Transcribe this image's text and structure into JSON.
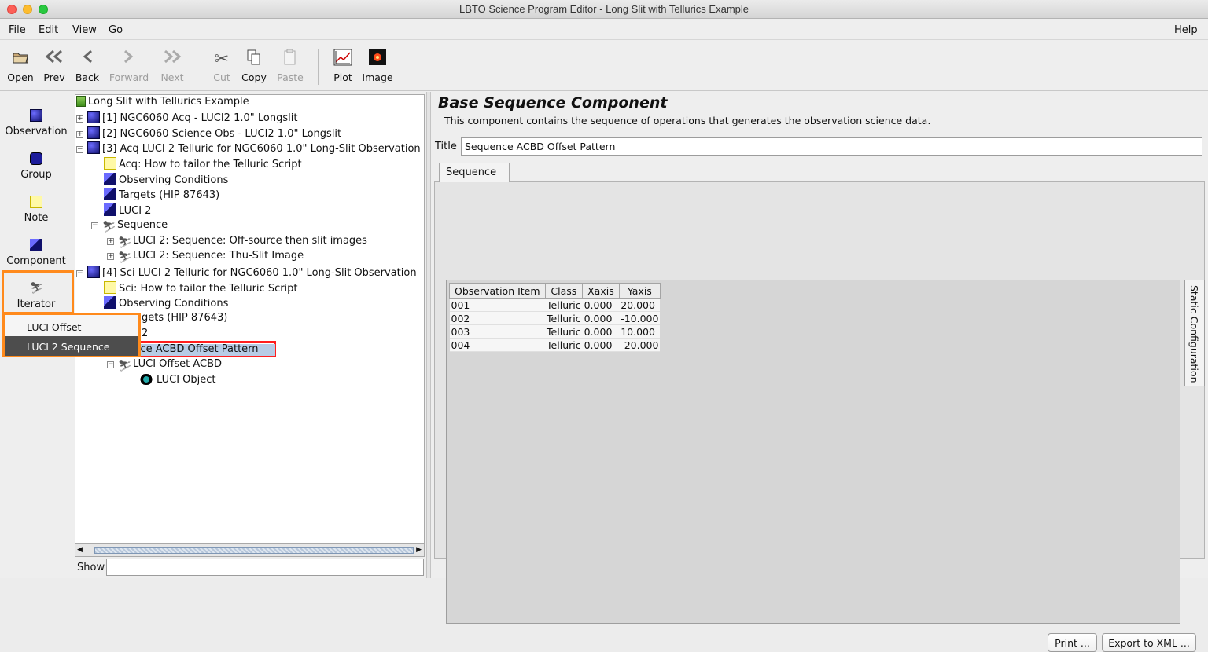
{
  "window": {
    "title": "LBTO Science Program Editor - Long Slit with Tellurics Example"
  },
  "menu": {
    "file": "File",
    "edit": "Edit",
    "view": "View",
    "go": "Go",
    "help": "Help"
  },
  "toolbar": {
    "open": "Open",
    "prev": "Prev",
    "back": "Back",
    "forward": "Forward",
    "next": "Next",
    "cut": "Cut",
    "copy": "Copy",
    "paste": "Paste",
    "plot": "Plot",
    "image": "Image"
  },
  "palette": {
    "observation": "Observation",
    "group": "Group",
    "note": "Note",
    "component": "Component",
    "iterator": "Iterator"
  },
  "iterator_popup": {
    "items": [
      "LUCI Offset",
      "LUCI 2 Sequence"
    ],
    "selected": "LUCI 2 Sequence"
  },
  "tree": {
    "root": "Long Slit with Tellurics Example",
    "n1": "[1] NGC6060 Acq - LUCI2 1.0\" Longslit",
    "n2": "[2] NGC6060 Science Obs - LUCI2 1.0\" Longslit",
    "n3": "[3] Acq LUCI 2 Telluric for NGC6060 1.0\" Long-Slit Observation",
    "n3_note": "Acq: How to tailor the Telluric Script",
    "n3_cond": "Observing Conditions",
    "n3_targets": "Targets (HIP 87643)",
    "n3_inst": "LUCI 2",
    "n3_seq": "Sequence",
    "n3_seq_a": "LUCI 2: Sequence: Off-source then slit images",
    "n3_seq_b": "LUCI 2: Sequence: Thu-Slit Image",
    "n4": "[4] Sci LUCI 2 Telluric for NGC6060 1.0\" Long-Slit Observation",
    "n4_note": "Sci: How to tailor the Telluric Script",
    "n4_cond": "Observing Conditions",
    "n4_targets_visible": "gets (HIP 87643)",
    "n4_inst_visible": "2",
    "n4_seq_visible": "uence ACBD Offset Pattern",
    "n4_offset": "LUCI Offset ACBD",
    "n4_object": "LUCI Object"
  },
  "show": {
    "label": "Show",
    "value": ""
  },
  "component": {
    "heading": "Base Sequence Component",
    "description": "This component contains the sequence of operations that generates the observation science data.",
    "title_label": "Title",
    "title_value": "Sequence ACBD Offset Pattern",
    "tab": "Sequence",
    "static_tab": "Static Configuration",
    "columns": [
      "Observation Item",
      "Class",
      "Xaxis",
      "Yaxis"
    ],
    "rows": [
      [
        "001",
        "Telluric",
        "0.000",
        "20.000"
      ],
      [
        "002",
        "Telluric",
        "0.000",
        "-10.000"
      ],
      [
        "003",
        "Telluric",
        "0.000",
        "10.000"
      ],
      [
        "004",
        "Telluric",
        "0.000",
        "-20.000"
      ]
    ],
    "print": "Print ...",
    "export": "Export to XML ..."
  },
  "colors": {
    "highlight_orange": "#ff8a1c",
    "highlight_red": "#ff1e1e",
    "selection": "#b7cce6"
  }
}
